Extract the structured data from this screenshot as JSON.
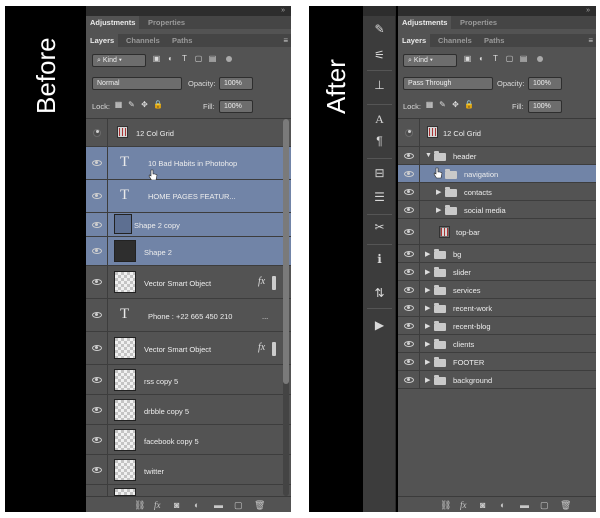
{
  "before": {
    "side_label": "Before",
    "tabs_top": [
      "Adjustments",
      "Properties"
    ],
    "tabs_bottom": [
      "Layers",
      "Channels",
      "Paths"
    ],
    "filter": {
      "kind": "Kind"
    },
    "blend_mode": "Normal",
    "opacity_label": "Opacity:",
    "opacity_value": "100%",
    "lock_label": "Lock:",
    "fill_label": "Fill:",
    "fill_value": "100%",
    "layers": [
      {
        "name": "12 Col Grid",
        "kind": "grid",
        "visible": false,
        "selected": false
      },
      {
        "name": "10 Bad Habits in Photohop",
        "kind": "text",
        "visible": true,
        "selected": true
      },
      {
        "name": "HOME          PAGES          FEATUR...",
        "kind": "text",
        "visible": true,
        "selected": true
      },
      {
        "name": "Shape 2 copy",
        "kind": "shape",
        "visible": true,
        "selected": true
      },
      {
        "name": "Shape 2",
        "kind": "shape",
        "visible": true,
        "selected": true
      },
      {
        "name": "Vector Smart Object",
        "kind": "smart",
        "visible": true,
        "selected": false,
        "fx": "fx"
      },
      {
        "name": "Phone : +22 665 450 210",
        "kind": "text",
        "visible": true,
        "selected": false,
        "suffix": "..."
      },
      {
        "name": "Vector Smart Object",
        "kind": "smart",
        "visible": true,
        "selected": false,
        "fx": "fx"
      },
      {
        "name": "rss copy 5",
        "kind": "raster",
        "visible": true,
        "selected": false
      },
      {
        "name": "drbble copy 5",
        "kind": "raster",
        "visible": true,
        "selected": false
      },
      {
        "name": "facebook copy 5",
        "kind": "raster",
        "visible": true,
        "selected": false
      },
      {
        "name": "twitter",
        "kind": "raster",
        "visible": true,
        "selected": false
      }
    ]
  },
  "after": {
    "side_label": "After",
    "tabs_top": [
      "Adjustments",
      "Properties"
    ],
    "tabs_bottom": [
      "Layers",
      "Channels",
      "Paths"
    ],
    "filter": {
      "kind": "Kind"
    },
    "blend_mode": "Pass Through",
    "opacity_label": "Opacity:",
    "opacity_value": "100%",
    "lock_label": "Lock:",
    "fill_label": "Fill:",
    "fill_value": "100%",
    "layers": [
      {
        "name": "12 Col Grid",
        "kind": "grid",
        "visible": false,
        "depth": 0
      },
      {
        "name": "header",
        "kind": "folder-open",
        "visible": true,
        "depth": 0
      },
      {
        "name": "navigation",
        "kind": "folder",
        "visible": true,
        "depth": 1,
        "selected": true
      },
      {
        "name": "contacts",
        "kind": "folder",
        "visible": true,
        "depth": 1
      },
      {
        "name": "social media",
        "kind": "folder",
        "visible": true,
        "depth": 1
      },
      {
        "name": "top-bar",
        "kind": "layer",
        "visible": true,
        "depth": 1
      },
      {
        "name": "bg",
        "kind": "folder",
        "visible": true,
        "depth": 0
      },
      {
        "name": "slider",
        "kind": "folder",
        "visible": true,
        "depth": 0
      },
      {
        "name": "services",
        "kind": "folder",
        "visible": true,
        "depth": 0
      },
      {
        "name": "recent-work",
        "kind": "folder",
        "visible": true,
        "depth": 0
      },
      {
        "name": "recent-blog",
        "kind": "folder",
        "visible": true,
        "depth": 0
      },
      {
        "name": "clients",
        "kind": "folder",
        "visible": true,
        "depth": 0
      },
      {
        "name": "FOOTER",
        "kind": "folder",
        "visible": true,
        "depth": 0
      },
      {
        "name": "background",
        "kind": "folder",
        "visible": true,
        "depth": 0
      }
    ],
    "toolbar_icons": [
      "brush-presets-icon",
      "clone-source-icon",
      "adjustments-icon",
      "character-icon",
      "paragraph-icon",
      "history-icon",
      "notes-icon",
      "tools-icon",
      "info-icon",
      "layer-comps-icon",
      "actions-icon"
    ]
  },
  "colors": {
    "panel": "#535353",
    "selection": "#7184a7",
    "background": "#000000"
  }
}
